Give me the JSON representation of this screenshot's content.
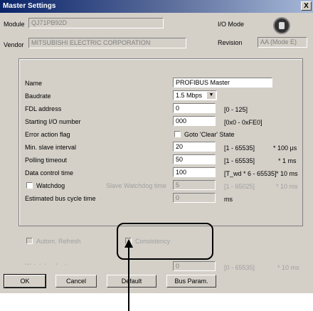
{
  "window": {
    "title": "Master Settings",
    "close_label": "X"
  },
  "header": {
    "module_label": "Module",
    "module_value": "QJ71PB92D",
    "vendor_label": "Vendor",
    "vendor_value": "MITSUBISHI ELECTRIC CORPORATION",
    "io_mode_label": "I/O Mode",
    "revision_label": "Revision",
    "revision_value": "AA (Mode E)"
  },
  "params": {
    "name_label": "Name",
    "name_value": "PROFIBUS Master",
    "baudrate_label": "Baudrate",
    "baudrate_value": "1.5 Mbps",
    "fdl_label": "FDL address",
    "fdl_value": "0",
    "fdl_range": "[0 - 125]",
    "starting_io_label": "Starting I/O number",
    "starting_io_value": "000",
    "starting_io_range": "[0x0 - 0xFE0]",
    "error_action_label": "Error action flag",
    "goto_clear_label": "Goto 'Clear' State",
    "min_slave_label": "Min. slave interval",
    "min_slave_value": "20",
    "min_slave_range": "[1 - 65535]",
    "min_slave_unit": "* 100 µs",
    "polling_label": "Polling timeout",
    "polling_value": "50",
    "polling_range": "[1 - 65535]",
    "polling_unit": "* 1 ms",
    "data_control_label": "Data control time",
    "data_control_value": "100",
    "data_control_range": "[T_wd * 6 - 65535]",
    "data_control_unit": "* 10 ms",
    "watchdog_label": "Watchdog",
    "slave_watchdog_label": "Slave Watchdog time",
    "slave_watchdog_value": "5",
    "slave_watchdog_range": "[1 - 65025]",
    "slave_watchdog_unit": "* 10 ms",
    "bus_cycle_label": "Estimated bus cycle time",
    "bus_cycle_value": "0",
    "bus_cycle_unit": "ms"
  },
  "refresh": {
    "autom_refresh_label": "Autom. Refresh",
    "consistency_label": "Consistency",
    "watchdog_sync_label": "Watchdog for time sync.",
    "watchdog_sync_value": "0",
    "watchdog_sync_range": "[0 - 65535]",
    "watchdog_sync_unit": "* 10 ms"
  },
  "buttons": {
    "ok": "OK",
    "cancel": "Cancel",
    "default": "Default",
    "bus_param": "Bus Param."
  }
}
